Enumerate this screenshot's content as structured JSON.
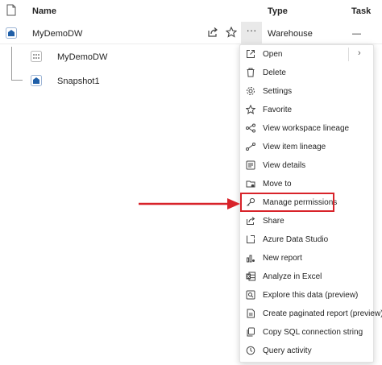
{
  "header": {
    "name_label": "Name",
    "type_label": "Type",
    "task_label": "Task"
  },
  "rows": [
    {
      "name": "MyDemoDW",
      "type": "Warehouse",
      "task": "—",
      "icon": "warehouse-icon"
    },
    {
      "name": "MyDemoDW",
      "icon": "sql-endpoint-icon"
    },
    {
      "name": "Snapshot1",
      "icon": "snapshot-icon"
    }
  ],
  "row_actions": {
    "more_label": "···"
  },
  "menu": {
    "items": [
      {
        "label": "Open",
        "icon": "open-external-icon",
        "has_submenu": true
      },
      {
        "label": "Delete",
        "icon": "trash-icon"
      },
      {
        "label": "Settings",
        "icon": "gear-icon"
      },
      {
        "label": "Favorite",
        "icon": "star-icon"
      },
      {
        "label": "View workspace lineage",
        "icon": "lineage-icon"
      },
      {
        "label": "View item lineage",
        "icon": "item-lineage-icon"
      },
      {
        "label": "View details",
        "icon": "details-icon"
      },
      {
        "label": "Move to",
        "icon": "move-to-icon"
      },
      {
        "label": "Manage permissions",
        "icon": "key-icon",
        "highlighted": true
      },
      {
        "label": "Share",
        "icon": "share-icon"
      },
      {
        "label": "Azure Data Studio",
        "icon": "azure-data-studio-icon"
      },
      {
        "label": "New report",
        "icon": "new-report-icon"
      },
      {
        "label": "Analyze in Excel",
        "icon": "excel-icon"
      },
      {
        "label": "Explore this data (preview)",
        "icon": "explore-icon"
      },
      {
        "label": "Create paginated report (preview)",
        "icon": "paginated-report-icon"
      },
      {
        "label": "Copy SQL connection string",
        "icon": "copy-icon"
      },
      {
        "label": "Query activity",
        "icon": "query-activity-icon"
      }
    ],
    "chevron": "›"
  },
  "colors": {
    "highlight": "#d8232a",
    "arrow": "#d8232a",
    "warehouse_icon": "#1f5fa8",
    "more_button_bg": "#e9e9e9"
  }
}
